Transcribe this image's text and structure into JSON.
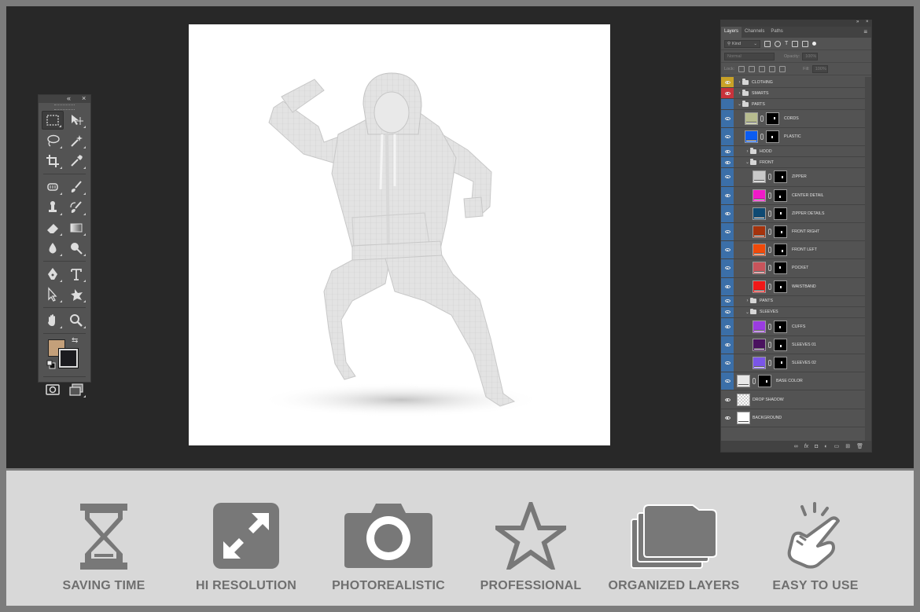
{
  "tools_panel": {
    "collapse_icon": "double-chevron-left-icon",
    "close_icon": "close-icon",
    "tools": [
      [
        "marquee-icon",
        "move-icon"
      ],
      [
        "lasso-icon",
        "magic-wand-icon"
      ],
      [
        "crop-icon",
        "eyedropper-icon"
      ],
      [
        "healing-brush-icon",
        "brush-icon"
      ],
      [
        "clone-stamp-icon",
        "history-brush-icon"
      ],
      [
        "eraser-icon",
        "gradient-icon"
      ],
      [
        "blur-icon",
        "dodge-icon"
      ],
      [
        "pen-icon",
        "type-icon"
      ],
      [
        "path-selection-icon",
        "shape-icon"
      ],
      [
        "hand-icon",
        "zoom-icon"
      ]
    ],
    "foreground_color": "#c4a07a",
    "background_color": "#1b1b1f"
  },
  "layers_panel": {
    "tabs": [
      "Layers",
      "Channels",
      "Paths"
    ],
    "filter_label": "Kind",
    "blend_mode": "Normal",
    "opacity_label": "Opacity:",
    "opacity_value": "100%",
    "lock_label": "Lock:",
    "fill_label": "Fill:",
    "fill_value": "100%",
    "layers": [
      {
        "name": "CLOTHING",
        "kind": "group",
        "indent": 0,
        "expanded": false,
        "tag": "#c9a227"
      },
      {
        "name": "SMARTS",
        "kind": "group",
        "indent": 0,
        "expanded": false,
        "tag": "#c8333b"
      },
      {
        "name": "PARTS",
        "kind": "group",
        "indent": 0,
        "expanded": true,
        "tag": "#3b6fa8",
        "eye": false
      },
      {
        "name": "CORDS",
        "kind": "layer",
        "indent": 1,
        "color": "#b7bc8f",
        "tag": "#3b6fa8"
      },
      {
        "name": "PLASTIC",
        "kind": "layer",
        "indent": 1,
        "color": "#0b5cf2",
        "tag": "#3b6fa8"
      },
      {
        "name": "HOOD",
        "kind": "group",
        "indent": 1,
        "expanded": false,
        "tag": "#3b6fa8"
      },
      {
        "name": "FRONT",
        "kind": "group",
        "indent": 1,
        "expanded": true,
        "tag": "#3b6fa8"
      },
      {
        "name": "ZIPPER",
        "kind": "layer",
        "indent": 2,
        "color": "#c9c9c9",
        "tag": "#3b6fa8"
      },
      {
        "name": "CENTER DETAIL",
        "kind": "layer",
        "indent": 2,
        "color": "#f01ac8",
        "tag": "#3b6fa8"
      },
      {
        "name": "ZIPPER DETAILS",
        "kind": "layer",
        "indent": 2,
        "color": "#0f4a73",
        "tag": "#3b6fa8"
      },
      {
        "name": "FRONT RIGHT",
        "kind": "layer",
        "indent": 2,
        "color": "#a5330d",
        "tag": "#3b6fa8"
      },
      {
        "name": "FRONT LEFT",
        "kind": "layer",
        "indent": 2,
        "color": "#f04a0a",
        "tag": "#3b6fa8"
      },
      {
        "name": "POCKET",
        "kind": "layer",
        "indent": 2,
        "color": "#c8545b",
        "tag": "#3b6fa8"
      },
      {
        "name": "WAISTBAND",
        "kind": "layer",
        "indent": 2,
        "color": "#f01818",
        "tag": "#3b6fa8"
      },
      {
        "name": "PANTS",
        "kind": "group",
        "indent": 1,
        "expanded": false,
        "tag": "#3b6fa8"
      },
      {
        "name": "SLEEVES",
        "kind": "group",
        "indent": 1,
        "expanded": true,
        "tag": "#3b6fa8"
      },
      {
        "name": "CUFFS",
        "kind": "layer",
        "indent": 2,
        "color": "#9a3ce0",
        "tag": "#3b6fa8"
      },
      {
        "name": "SLEEVES 01",
        "kind": "layer",
        "indent": 2,
        "color": "#4a125f",
        "tag": "#3b6fa8"
      },
      {
        "name": "SLEEVES 02",
        "kind": "layer",
        "indent": 2,
        "color": "#7a55e8",
        "tag": "#3b6fa8"
      },
      {
        "name": "BASE COLOR",
        "kind": "layer",
        "indent": 0,
        "color": "#e8e8e8",
        "tag": "#3b6fa8"
      },
      {
        "name": "DROP SHADOW",
        "kind": "layer",
        "indent": 0,
        "color": "checker",
        "tag": "#535353"
      },
      {
        "name": "BACKGROUND",
        "kind": "layer",
        "indent": 0,
        "color": "#ffffff",
        "tag": "#535353"
      }
    ]
  },
  "features": [
    {
      "label": "SAVING TIME",
      "icon": "hourglass-icon"
    },
    {
      "label": "HI RESOLUTION",
      "icon": "expand-arrows-icon"
    },
    {
      "label": "PHOTOREALISTIC",
      "icon": "camera-icon"
    },
    {
      "label": "PROFESSIONAL",
      "icon": "star-icon"
    },
    {
      "label": "ORGANIZED LAYERS",
      "icon": "stacked-folders-icon"
    },
    {
      "label": "EASY TO USE",
      "icon": "pointing-hand-icon"
    }
  ],
  "colors": {
    "workspace_bg": "#282828",
    "panel_bg": "#535353",
    "feature_icon": "#787878",
    "feature_text": "#6f6f6f"
  }
}
